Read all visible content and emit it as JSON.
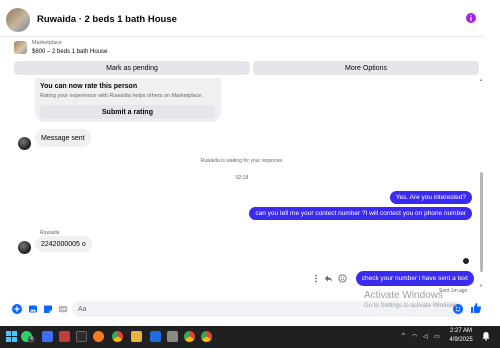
{
  "header": {
    "title": "Ruwaida · 2 beds 1 bath House"
  },
  "marketplace": {
    "label": "Marketplace",
    "listing": "$600 – 2 beds 1 bath House",
    "mark_pending_label": "Mark as pending",
    "more_options_label": "More Options"
  },
  "rating_card": {
    "title": "You can now rate this person",
    "subtitle": "Rating your experience with Ruwaida helps others on Marketplace.",
    "button_label": "Submit a rating"
  },
  "messages": {
    "system_sent": "Message sent",
    "waiting_note": "Ruwaida is waiting for your response.",
    "timestamp": "02:18",
    "out_1": "Yes. Are you interested?",
    "out_2": "can you tell me your contect number ?I will contect you on phone number",
    "sender_name": "Ruwaida",
    "in_1": "2242000005 o",
    "out_3": "check your number i have sent a text",
    "sent_status": "Sent 1m ago"
  },
  "composer": {
    "placeholder": "Aa"
  },
  "watermark": {
    "title": "Activate Windows",
    "subtitle": "Go to Settings to activate Windows."
  },
  "taskbar": {
    "time": "2:27 AM",
    "date": "4/9/2025",
    "whatsapp_badge": "4"
  },
  "colors": {
    "accent": "#3b2bf0",
    "messenger_blue": "#0866ff",
    "info_purple": "#a020f0"
  }
}
